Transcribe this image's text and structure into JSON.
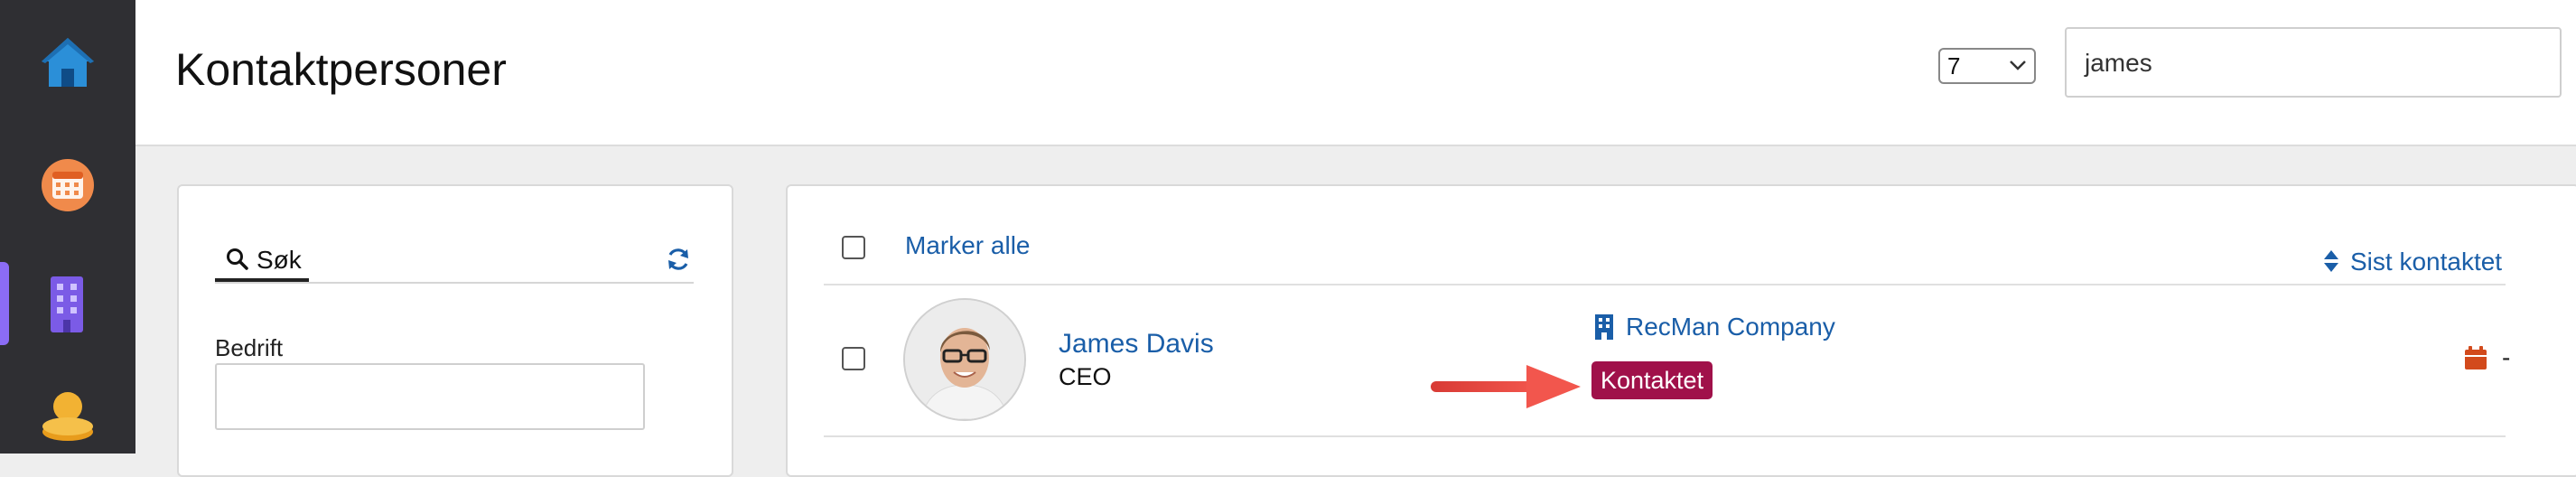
{
  "colors": {
    "rail_bg": "#2f2f33",
    "rail_active": "#8b6cf5",
    "link": "#1a5ea8",
    "status_badge": "#a0114a",
    "arrow": "#ef4a42",
    "calendar": "#d24a1c"
  },
  "rail": {
    "items": [
      {
        "icon": "home-icon"
      },
      {
        "icon": "calendar-icon"
      },
      {
        "icon": "building-icon",
        "active": true
      },
      {
        "icon": "coins-icon"
      }
    ]
  },
  "header": {
    "title": "Kontaktpersoner",
    "per_page": {
      "value": "7"
    },
    "search": {
      "value": "james"
    }
  },
  "filter": {
    "tab_label": "Søk",
    "tab_icon": "search-icon",
    "refresh_icon": "refresh-icon",
    "company_label": "Bedrift",
    "company_value": ""
  },
  "results": {
    "select_all_label": "Marker alle",
    "sort_label": "Sist kontaktet",
    "sort_icon": "sort-icon",
    "rows": [
      {
        "name": "James Davis",
        "title": "CEO",
        "company": "RecMan Company",
        "company_icon": "building-icon",
        "status": "Kontaktet",
        "last_contacted": "-",
        "last_contacted_icon": "calendar-icon"
      }
    ]
  }
}
